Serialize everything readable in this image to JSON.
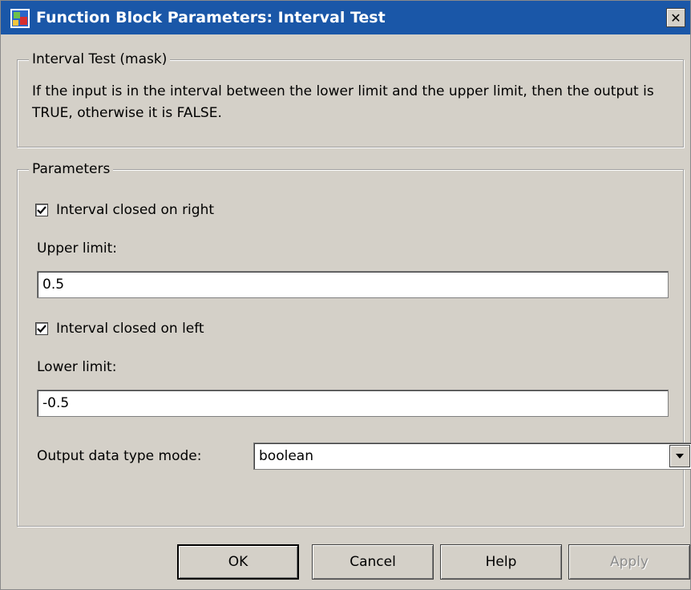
{
  "window": {
    "title": "Function Block Parameters: Interval Test",
    "close_glyph": "✕",
    "titlebar_color": "#1a57a8"
  },
  "mask": {
    "legend": "Interval Test (mask)",
    "description": "If the input is in the interval between the lower limit and the upper limit, then the output is TRUE, otherwise it is FALSE."
  },
  "parameters": {
    "legend": "Parameters",
    "closed_right": {
      "label": "Interval closed on right",
      "checked": true
    },
    "upper_limit": {
      "label": "Upper limit:",
      "value": "0.5"
    },
    "closed_left": {
      "label": "Interval closed on left",
      "checked": true
    },
    "lower_limit": {
      "label": "Lower limit:",
      "value": "-0.5"
    },
    "output_mode": {
      "label": "Output data type mode:",
      "value": "boolean"
    }
  },
  "buttons": {
    "ok": "OK",
    "cancel": "Cancel",
    "help": "Help",
    "apply": "Apply"
  }
}
